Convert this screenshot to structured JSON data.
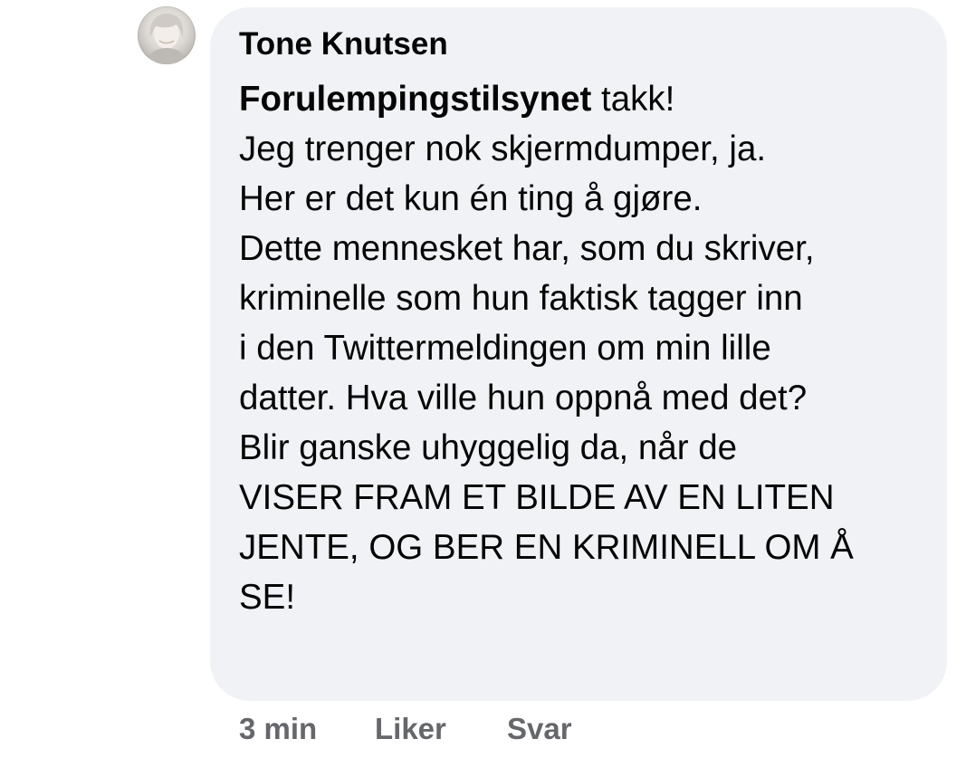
{
  "comment": {
    "author": "Tone Knutsen",
    "mention": "Forulempingstilsynet",
    "first_line_rest": " takk!",
    "lines": [
      "Jeg trenger nok skjermdumper, ja.",
      "Her er det kun én ting å gjøre.",
      "Dette mennesket har, som du skriver,",
      "kriminelle som hun faktisk tagger inn",
      "i den Twittermeldingen om min lille",
      "datter. Hva ville hun oppnå med det?",
      "Blir ganske uhyggelig da, når de",
      "VISER FRAM ET BILDE AV EN LITEN",
      "JENTE, OG BER EN KRIMINELL OM Å",
      "SE!"
    ]
  },
  "actions": {
    "time": "3 min",
    "like": "Liker",
    "reply": "Svar"
  },
  "icons": {
    "avatar": "profile-photo"
  },
  "colors": {
    "bubble_bg": "#f0f2f5",
    "text": "#050505",
    "secondary_text": "#65676b"
  }
}
